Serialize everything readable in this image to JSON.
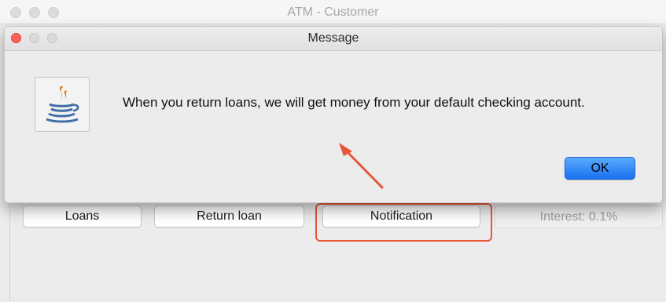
{
  "background_window": {
    "title": "ATM - Customer",
    "buttons": {
      "loans": "Loans",
      "return_loan": "Return loan",
      "notification": "Notification"
    },
    "interest_label": "Interest: 0.1%"
  },
  "dialog": {
    "title": "Message",
    "message": "When you return loans, we will get money from your default checking account.",
    "ok_label": "OK",
    "icon": "java-coffee-icon"
  },
  "annotations": {
    "highlight_color": "#e8563a",
    "arrow_color": "#e8563a"
  }
}
